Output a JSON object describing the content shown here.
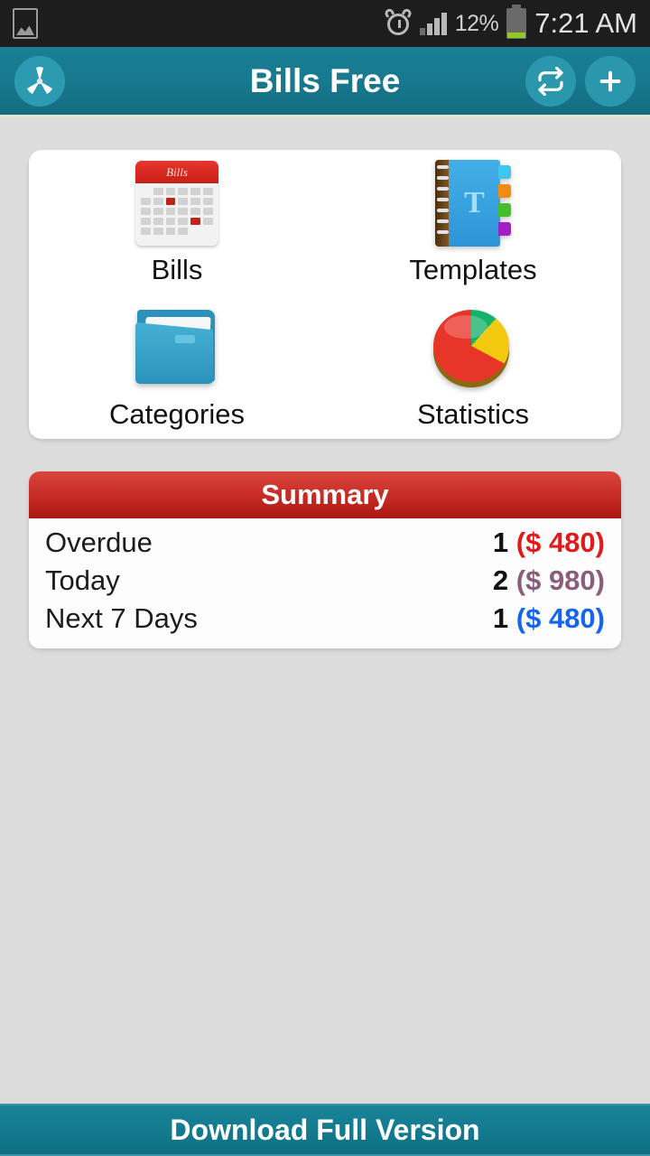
{
  "status_bar": {
    "image_icon": "image-icon",
    "alarm_icon": "alarm-clock-icon",
    "signal_icon": "signal-bars-icon",
    "battery_percent": "12%",
    "battery_icon": "battery-icon",
    "time": "7:21 AM"
  },
  "app_bar": {
    "logo_icon": "propeller-logo-icon",
    "title": "Bills Free",
    "repeat_icon": "repeat-icon",
    "add_icon": "plus-icon",
    "background_color": "#17798e"
  },
  "menu": {
    "items": [
      {
        "label": "Bills",
        "icon": "calendar-icon",
        "icon_title": "Bills"
      },
      {
        "label": "Templates",
        "icon": "notebook-icon",
        "icon_letter": "T"
      },
      {
        "label": "Categories",
        "icon": "folder-icon"
      },
      {
        "label": "Statistics",
        "icon": "pie-chart-icon"
      }
    ]
  },
  "summary": {
    "title": "Summary",
    "header_color": "#c62b24",
    "rows": [
      {
        "label": "Overdue",
        "count": "1",
        "amount": "($ 480)",
        "color": "#e01b1b"
      },
      {
        "label": "Today",
        "count": "2",
        "amount": "($ 980)",
        "color": "#8a5d7a"
      },
      {
        "label": "Next 7 Days",
        "count": "1",
        "amount": "($ 480)",
        "color": "#1565ee"
      }
    ]
  },
  "banner": {
    "label": "Download Full Version"
  }
}
